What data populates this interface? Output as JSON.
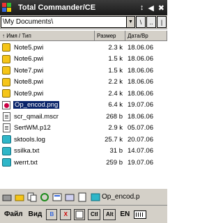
{
  "titlebar": {
    "title": "Total Commander/CE",
    "icons": [
      "windows-logo",
      "signal-icon",
      "volume-icon",
      "close-icon"
    ],
    "close": "✖",
    "volume": "◀",
    "signal": "↕"
  },
  "pathbar": {
    "path": "\\My Documents\\",
    "arrow": "▼",
    "buttons": [
      "\\",
      "..",
      "|"
    ]
  },
  "columns": {
    "name": "↑ Имя / Тип",
    "size": "Размер",
    "date": "Дата/Вр"
  },
  "files": [
    {
      "name": "Note5.pwi",
      "size": "2.3 k",
      "date": "18.06.06",
      "icon": "pwi"
    },
    {
      "name": "Note6.pwi",
      "size": "1.5 k",
      "date": "18.06.06",
      "icon": "pwi"
    },
    {
      "name": "Note7.pwi",
      "size": "1.5 k",
      "date": "18.06.06",
      "icon": "pwi"
    },
    {
      "name": "Note8.pwi",
      "size": "2.2 k",
      "date": "18.06.06",
      "icon": "pwi"
    },
    {
      "name": "Note9.pwi",
      "size": "2.4 k",
      "date": "18.06.06",
      "icon": "pwi"
    },
    {
      "name": "Op_encod.png",
      "size": "6.4 k",
      "date": "19.07.06",
      "icon": "png",
      "selected": true
    },
    {
      "name": "scr_qmail.mscr",
      "size": "268 b",
      "date": "18.06.06",
      "icon": "doc"
    },
    {
      "name": "SertWM.p12",
      "size": "2.9 k",
      "date": "05.07.06",
      "icon": "doc"
    },
    {
      "name": "sktools.log",
      "size": "25.7 k",
      "date": "20.07.06",
      "icon": "book"
    },
    {
      "name": "ssilka.txt",
      "size": "31 b",
      "date": "14.07.06",
      "icon": "book"
    },
    {
      "name": "werrt.txt",
      "size": "259 b",
      "date": "19.07.06",
      "icon": "book"
    }
  ],
  "drivebar": {
    "label": "Op_encod.p"
  },
  "menubar": {
    "file": "Файл",
    "view": "Вид",
    "ctl": "Ctl",
    "alt": "Alt",
    "lang": "EN",
    "delete": "X",
    "copy_mark": "B"
  }
}
